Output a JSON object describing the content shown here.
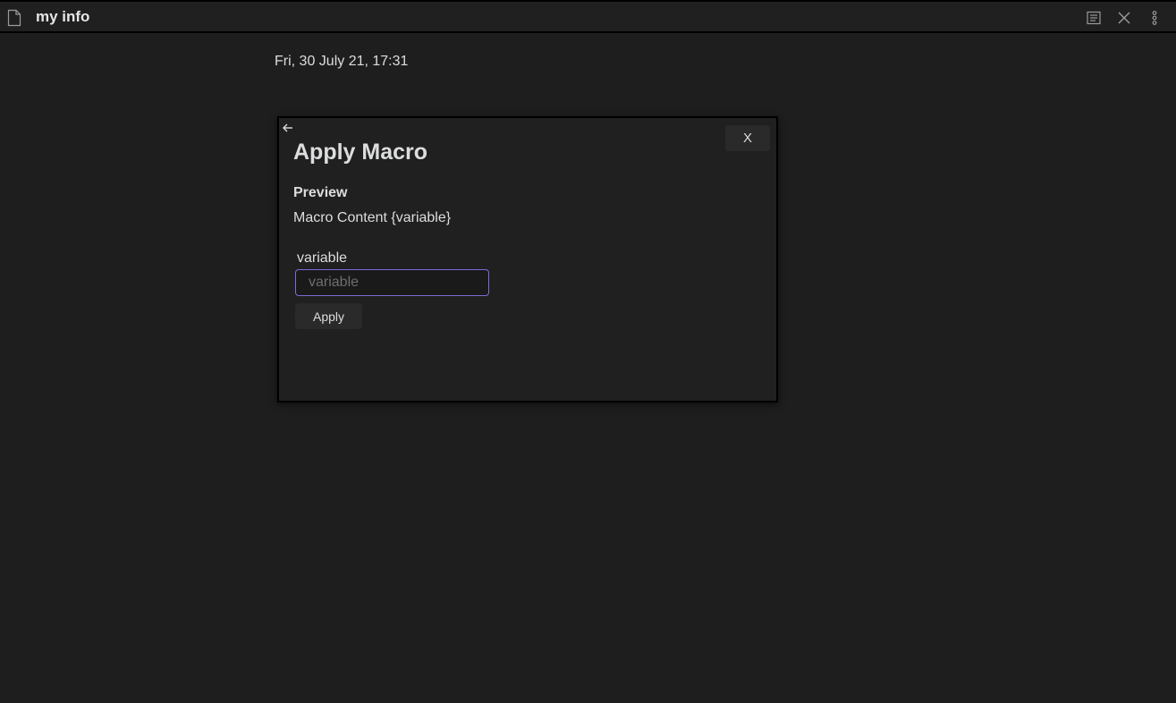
{
  "header": {
    "title": "my info",
    "icons": {
      "file": "file-icon",
      "reader": "reading-view-icon",
      "close": "close-pane-icon",
      "more": "more-options-icon"
    }
  },
  "note": {
    "timestamp": "Fri, 30 July 21, 17:31"
  },
  "modal": {
    "back_icon": "back-arrow-icon",
    "close_label": "X",
    "title": "Apply Macro",
    "preview_heading": "Preview",
    "preview_content": "Macro Content {variable}",
    "field_label": "variable",
    "field_placeholder": "variable",
    "field_value": "",
    "apply_label": "Apply"
  },
  "colors": {
    "background": "#1e1e1e",
    "accent_border": "#7b6cd9",
    "text": "#dcddde"
  }
}
